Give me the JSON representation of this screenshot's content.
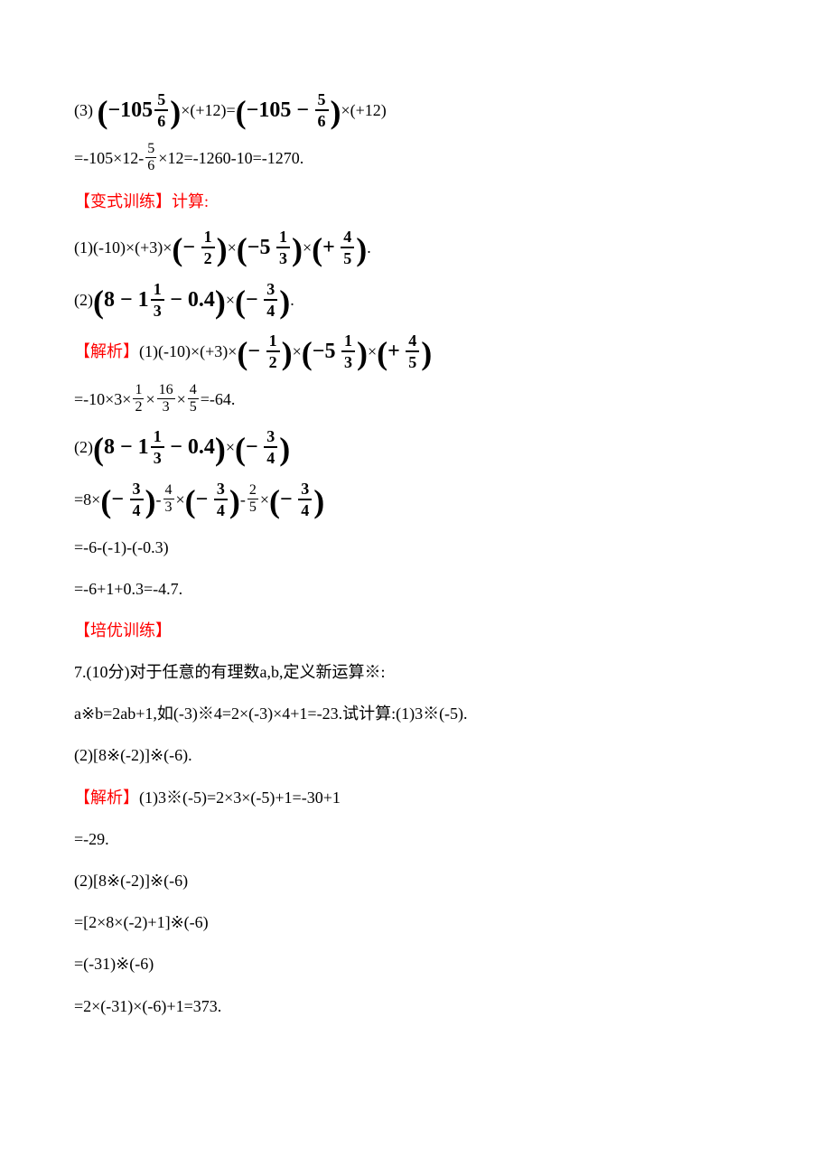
{
  "line1": {
    "p1": "(3)",
    "n1": "−105",
    "f1n": "5",
    "f1d": "6",
    "mid": "×(+12)=",
    "n2": "−105 −",
    "f2n": "5",
    "f2d": "6",
    "end": "×(+12)"
  },
  "line2": {
    "a": "=-105×12-",
    "fn": "5",
    "fd": "6",
    "b": "×12=-1260-10=-1270."
  },
  "bianshi": "【变式训练】计算:",
  "line3": {
    "a": "(1)(-10)×(+3)×",
    "f1pre": "−",
    "f1n": "1",
    "f1d": "2",
    "b": "×",
    "m2w": "−5",
    "f2n": "1",
    "f2d": "3",
    "c": "×",
    "f3pre": "+",
    "f3n": "4",
    "f3d": "5",
    "d": "."
  },
  "line4": {
    "a": "(2)",
    "inner1": "8 − 1",
    "f1n": "1",
    "f1d": "3",
    "inner2": "− 0.4",
    "b": "×",
    "f2pre": "−",
    "f2n": "3",
    "f2d": "4",
    "c": "."
  },
  "jiexi1": "【解析】",
  "line5": {
    "a": "(1)(-10)×(+3)×",
    "f1pre": "−",
    "f1n": "1",
    "f1d": "2",
    "b": "×",
    "m2w": "−5",
    "f2n": "1",
    "f2d": "3",
    "c": "×",
    "f3pre": "+",
    "f3n": "4",
    "f3d": "5"
  },
  "line6": {
    "a": "=-10×3×",
    "f1n": "1",
    "f1d": "2",
    "b": "×",
    "f2n": "16",
    "f2d": "3",
    "c": "×",
    "f3n": "4",
    "f3d": "5",
    "d": "=-64."
  },
  "line7": {
    "a": "(2)",
    "inner1": "8 − 1",
    "f1n": "1",
    "f1d": "3",
    "inner2": "− 0.4",
    "b": "×",
    "f2pre": "−",
    "f2n": "3",
    "f2d": "4"
  },
  "line8": {
    "a": "=8×",
    "f1pre": "−",
    "f1n": "3",
    "f1d": "4",
    "b": "-",
    "f2n": "4",
    "f2d": "3",
    "c": "×",
    "f3pre": "−",
    "f3n": "3",
    "f3d": "4",
    "d": "-",
    "f4n": "2",
    "f4d": "5",
    "e": "×",
    "f5pre": "−",
    "f5n": "3",
    "f5d": "4"
  },
  "line9": "=-6-(-1)-(-0.3)",
  "line10": "=-6+1+0.3=-4.7.",
  "peiyou": "【培优训练】",
  "line11": "7.(10分)对于任意的有理数a,b,定义新运算※:",
  "line12": "a※b=2ab+1,如(-3)※4=2×(-3)×4+1=-23.试计算:(1)3※(-5).",
  "line13": "(2)[8※(-2)]※(-6).",
  "jiexi2": "【解析】",
  "line14": "(1)3※(-5)=2×3×(-5)+1=-30+1",
  "line15": "=-29.",
  "line16": "(2)[8※(-2)]※(-6)",
  "line17": "=[2×8×(-2)+1]※(-6)",
  "line18": "=(-31)※(-6)",
  "line19": "=2×(-31)×(-6)+1=373."
}
